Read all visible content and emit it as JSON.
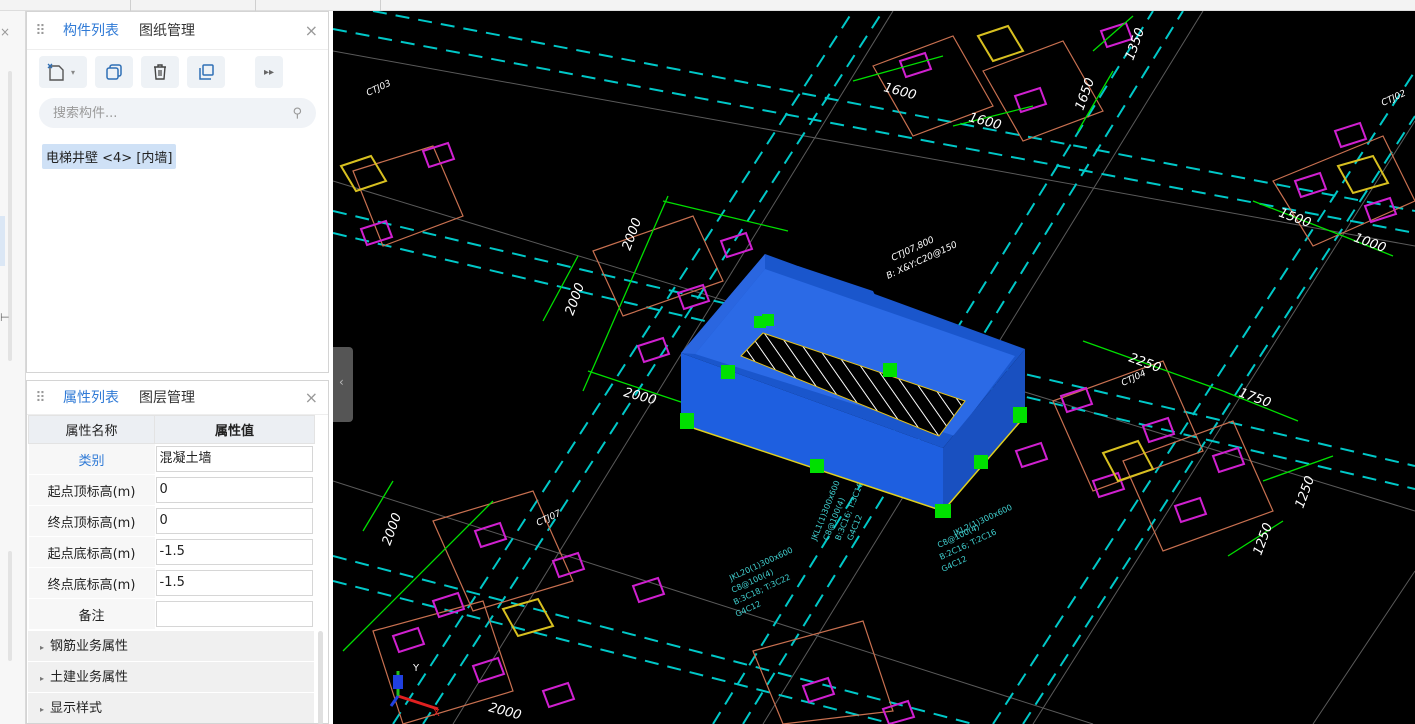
{
  "component_panel": {
    "tabs": [
      "构件列表",
      "图纸管理"
    ],
    "search_placeholder": "搜索构件...",
    "selected_item": "电梯井壁 <4> [内墙]",
    "toolbar_icons": [
      "new-component-icon",
      "copy-icon",
      "delete-icon",
      "layer-copy-icon",
      "more-icon"
    ]
  },
  "property_panel": {
    "tabs": [
      "属性列表",
      "图层管理"
    ],
    "col_name": "属性名称",
    "col_value": "属性值",
    "rows": [
      {
        "name": "类别",
        "value": "混凝土墙"
      },
      {
        "name": "起点顶标高(m)",
        "value": "0"
      },
      {
        "name": "终点顶标高(m)",
        "value": "0"
      },
      {
        "name": "起点底标高(m)",
        "value": "-1.5"
      },
      {
        "name": "终点底标高(m)",
        "value": "-1.5"
      },
      {
        "name": "备注",
        "value": ""
      }
    ],
    "groups": [
      "钢筋业务属性",
      "土建业务属性",
      "显示样式"
    ]
  },
  "drawing": {
    "dimensions": [
      "1600",
      "1600",
      "1650",
      "1350",
      "1500",
      "1000",
      "2000",
      "2000",
      "2000",
      "2250",
      "1750",
      "1250",
      "1250",
      "2000",
      "2000"
    ],
    "labels": [
      "CTJ03",
      "CTJ02",
      "CTJ07,800",
      "B: X&Y:C20@150",
      "CTJ04",
      "CTJ07",
      "JKL1(1)300x600",
      "C8@100(4)",
      "B:3C16; T:3C16",
      "G4C12",
      "JKL2(1)300x600",
      "C8@100(4)",
      "B:2C16; T:2C16",
      "G4C12",
      "JKL20(1)300x600",
      "C8@100(4)",
      "B:3C18; T:3C22",
      "G4C12"
    ],
    "axes": {
      "x": "X",
      "y": "Y"
    },
    "colors": {
      "background": "#000000",
      "wall": "#1f5fd6",
      "grip": "#00e000",
      "grid": "#00c8c8",
      "dim": "#00e000",
      "pile": "#d020d0",
      "cap": "#c87050"
    }
  }
}
